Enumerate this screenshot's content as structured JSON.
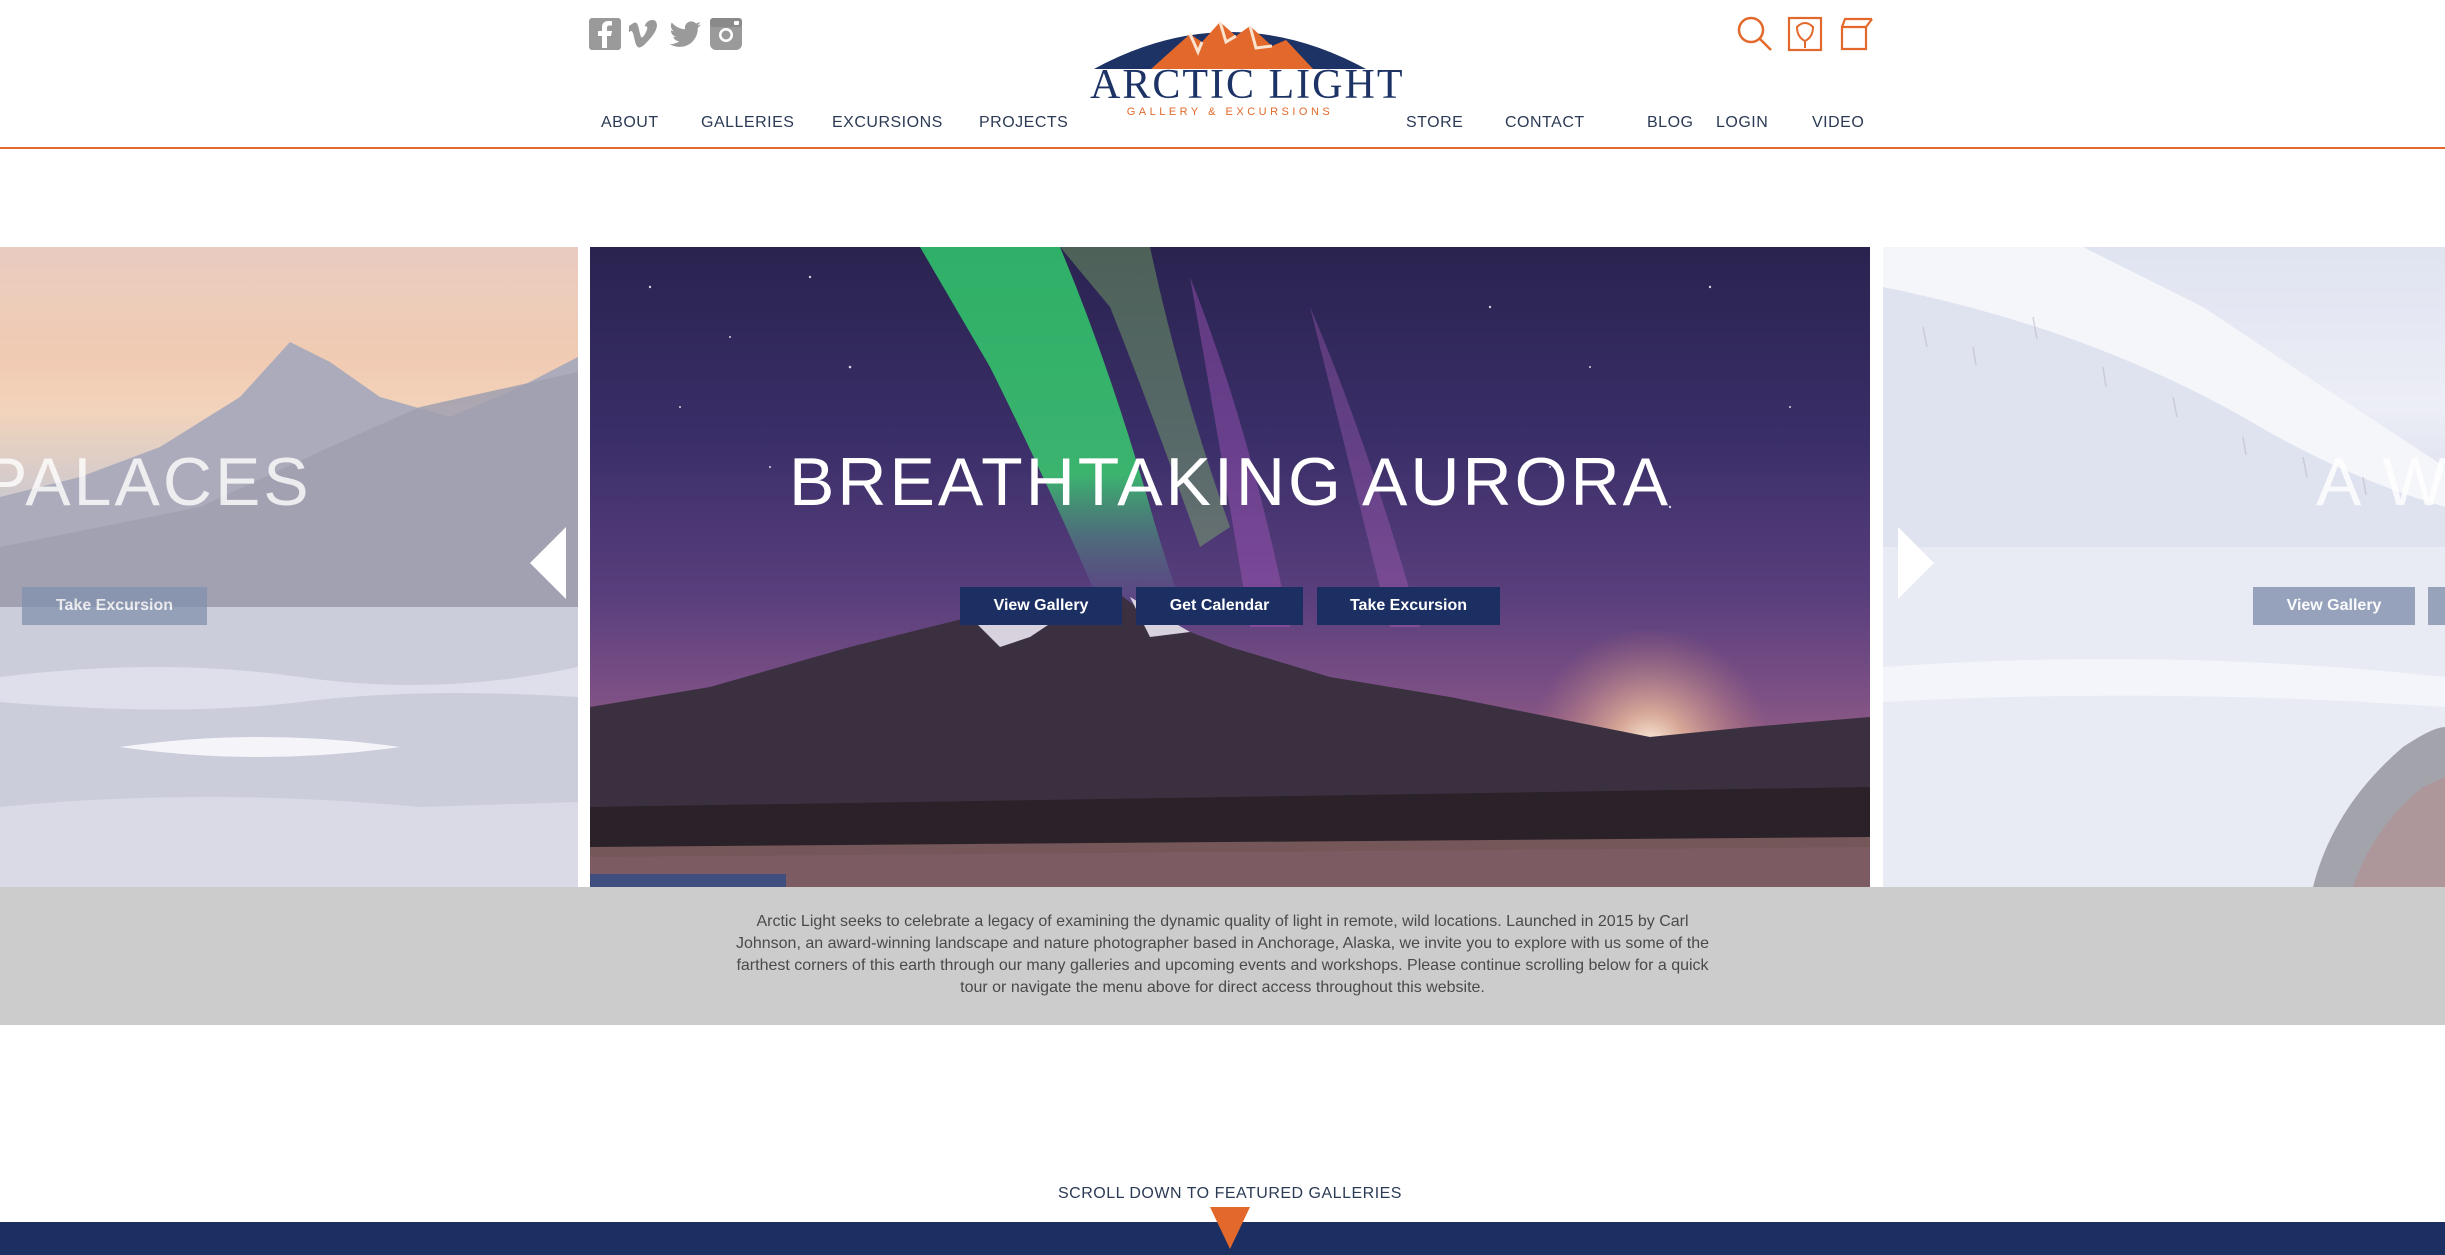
{
  "brand": {
    "title": "ARCTIC LIGHT",
    "subtitle": "GALLERY & EXCURSIONS",
    "colors": {
      "navy": "#1b2f63",
      "orange": "#e2692b",
      "gray_band": "#cccccc"
    }
  },
  "social": [
    {
      "name": "facebook-icon"
    },
    {
      "name": "vimeo-icon"
    },
    {
      "name": "twitter-icon"
    },
    {
      "name": "instagram-icon"
    }
  ],
  "utility": [
    {
      "name": "search-icon"
    },
    {
      "name": "account-icon"
    },
    {
      "name": "cart-icon"
    }
  ],
  "nav": {
    "left": [
      "ABOUT",
      "GALLERIES",
      "EXCURSIONS",
      "PROJECTS"
    ],
    "right": [
      "STORE",
      "CONTACT",
      "BLOG",
      "LOGIN",
      "VIDEO"
    ]
  },
  "slider": {
    "prev": {
      "title": "PALACES",
      "buttons": [
        "Take Excursion"
      ]
    },
    "current": {
      "title": "BREATHTAKING AURORA",
      "buttons": [
        "View Gallery",
        "Get Calendar",
        "Take Excursion"
      ]
    },
    "next": {
      "title": "A W",
      "buttons": [
        "View Gallery"
      ]
    },
    "arrows": {
      "prev": "arrow-left-icon",
      "next": "arrow-right-icon"
    }
  },
  "intro": {
    "text": "Arctic Light seeks to celebrate a legacy of examining the dynamic quality of light in remote, wild locations. Launched in 2015 by Carl Johnson, an award-winning landscape and nature photographer based in Anchorage, Alaska, we invite you to explore with us some of the farthest corners of this earth through our many galleries and upcoming events and workshops. Please continue scrolling below for a quick tour or navigate the menu above for direct access throughout this website."
  },
  "scroll": {
    "label": "SCROLL DOWN TO FEATURED GALLERIES",
    "icon": "triangle-down-icon"
  }
}
